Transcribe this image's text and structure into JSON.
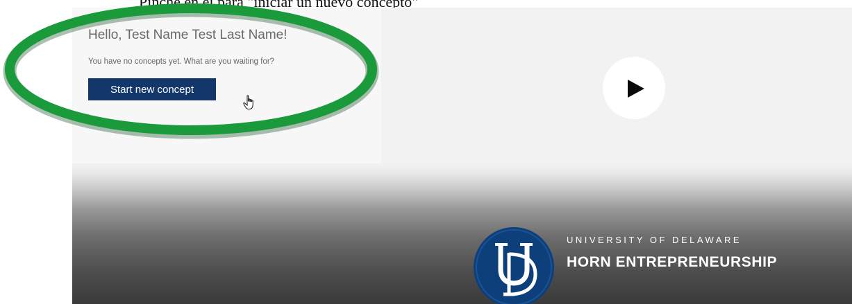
{
  "caption": "Pinche en el para \"iniciar un nuevo concepto\"",
  "app": {
    "greeting": "Hello, Test Name Test Last Name!",
    "empty_state": "You have no concepts yet. What are you waiting for?",
    "start_button_label": "Start new concept"
  },
  "video": {
    "play_icon": "play-icon"
  },
  "branding": {
    "university": "UNIVERSITY OF DELAWARE",
    "program": "HORN ENTREPRENEURSHIP",
    "seal_text": "UD",
    "seal_color": "#0d3f7a"
  },
  "annotation": {
    "highlight_color": "#1a9a3a"
  },
  "colors": {
    "button_bg": "#13376b"
  }
}
